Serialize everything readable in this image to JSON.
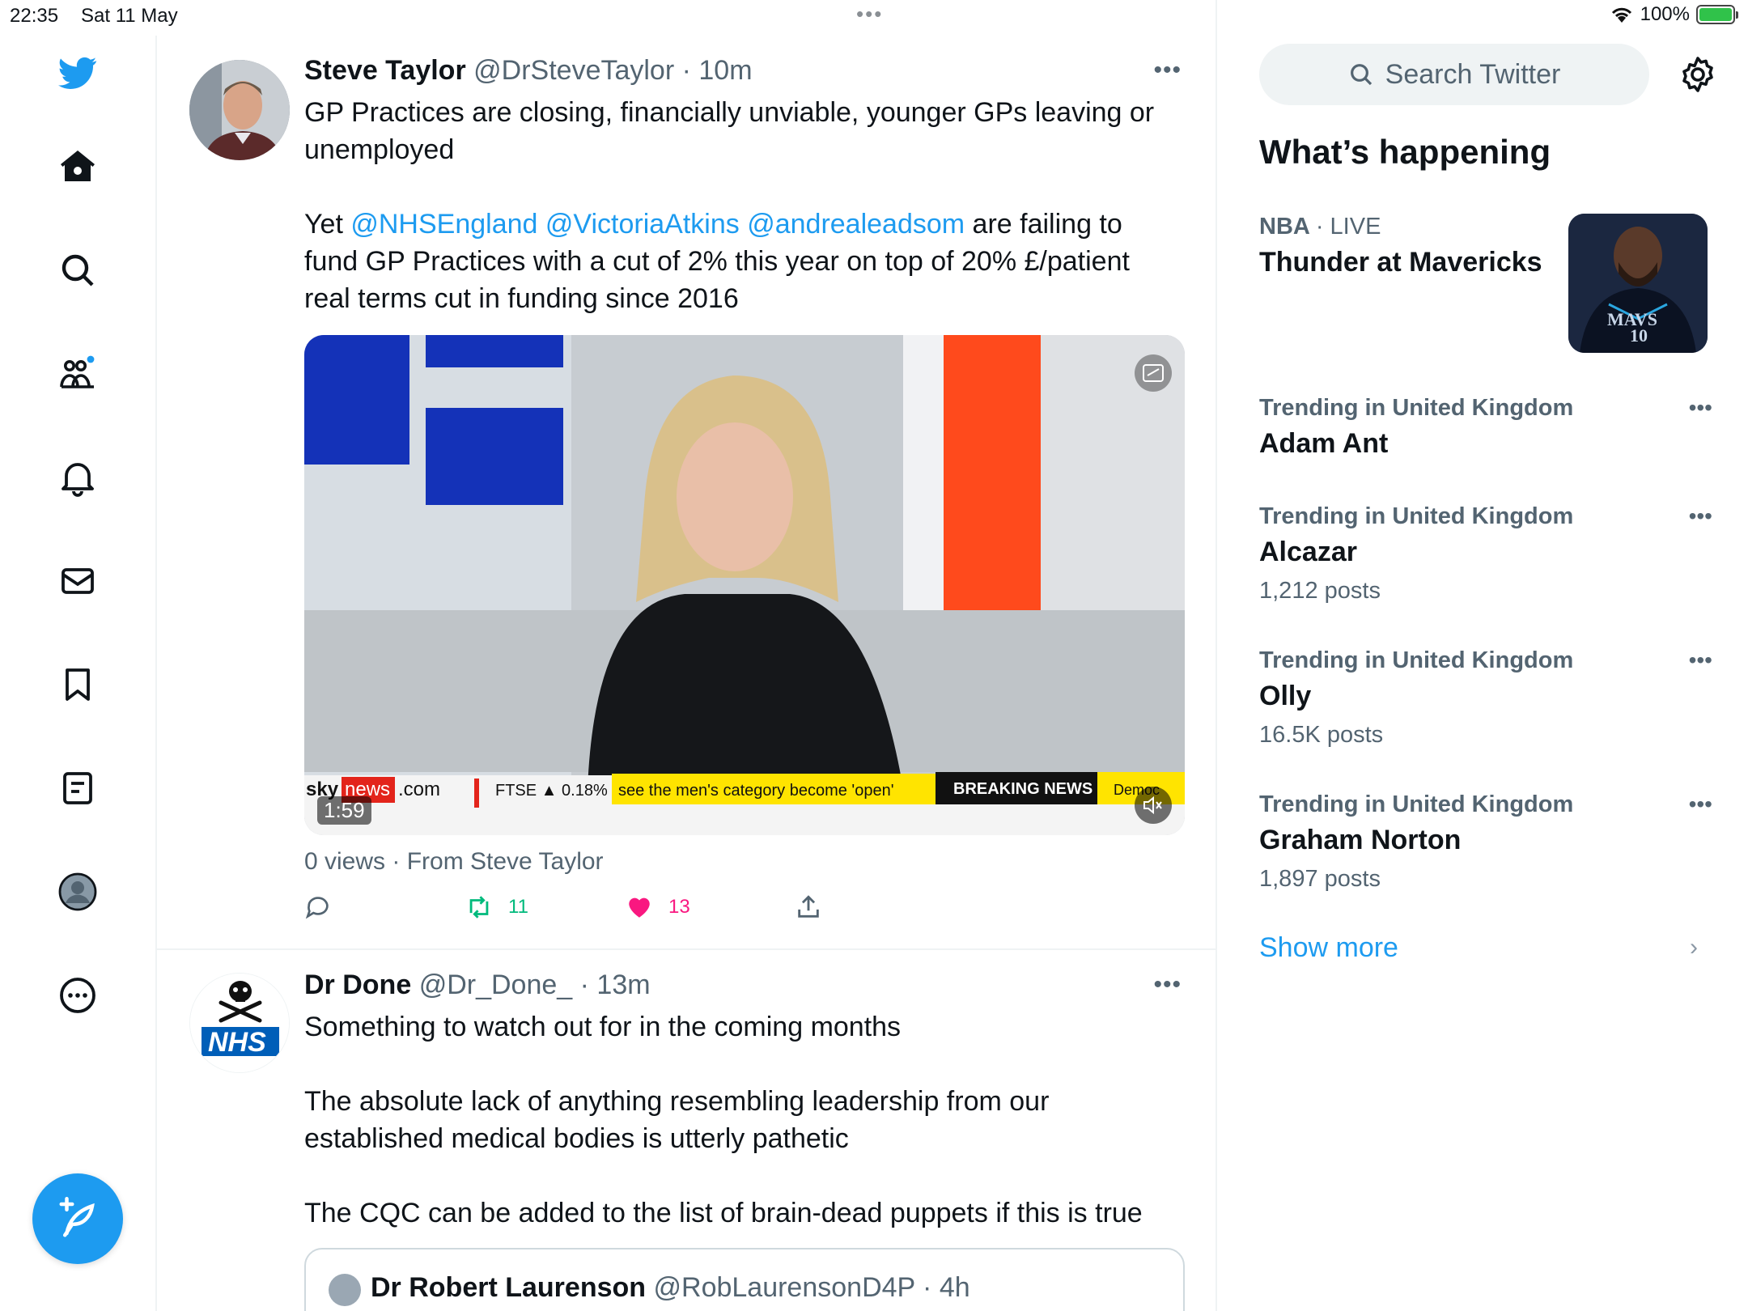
{
  "status_bar": {
    "time": "22:35",
    "date": "Sat 11 May",
    "battery": "100%",
    "battery_level": 1.0
  },
  "nav": {
    "items": [
      "twitter-logo",
      "home",
      "explore",
      "communities",
      "notifications",
      "messages",
      "bookmarks",
      "lists",
      "profile",
      "more"
    ]
  },
  "tweets": [
    {
      "name": "Steve Taylor",
      "handle": "@DrSteveTaylor",
      "time": "10m",
      "text_line1": "GP Practices are closing, financially unviable, younger GPs leaving or unemployed",
      "text_p2_prefix": "Yet ",
      "mentions": [
        "@NHSEngland",
        "@VictoriaAtkins",
        "@andrealeadsom"
      ],
      "text_p2_suffix": " are failing to fund GP Practices with a cut of 2% this year on top of 20% £/patient real terms cut in funding since 2016",
      "media": {
        "duration": "1:59",
        "ticker_logo_sky": "sky",
        "ticker_logo_news": "news",
        "ticker_logo_com": ".com",
        "ticker_ftse": "FTSE",
        "ticker_ftse_value": "0.18%",
        "ticker_text": "see the men's category become 'open'",
        "ticker_breaking": "BREAKING NEWS",
        "ticker_tail": "Democ"
      },
      "views": "0 views · From Steve Taylor",
      "retweets": "11",
      "likes": "13"
    },
    {
      "name": "Dr Done",
      "handle": "@Dr_Done_",
      "time": "13m",
      "avatar_text": "NHS",
      "paragraphs": [
        "Something to watch out for in the coming months",
        "The absolute lack of anything resembling leadership from our established medical bodies is utterly pathetic",
        "The CQC can be added to the list of brain-dead puppets if this is true"
      ],
      "quote": {
        "name": "Dr Robert Laurenson",
        "handle": "@RobLaurensonD4P",
        "time": "4h"
      }
    }
  ],
  "sidebar": {
    "search_placeholder": "Search Twitter",
    "whats_happening": "What’s happening",
    "trends": [
      {
        "context": "NBA",
        "live": "LIVE",
        "title": "Thunder at Mavericks",
        "count": ""
      },
      {
        "context": "Trending in United Kingdom",
        "title": "Adam Ant",
        "count": ""
      },
      {
        "context": "Trending in United Kingdom",
        "title": "Alcazar",
        "count": "1,212 posts"
      },
      {
        "context": "Trending in United Kingdom",
        "title": "Olly",
        "count": "16.5K posts"
      },
      {
        "context": "Trending in United Kingdom",
        "title": "Graham Norton",
        "count": "1,897 posts"
      }
    ],
    "show_more": "Show more",
    "jersey_text": "MAVS",
    "jersey_number": "10"
  },
  "colors": {
    "accent": "#1d9bf0",
    "retweet": "#00ba7c",
    "like": "#f91880",
    "secondary_text": "#536471"
  }
}
